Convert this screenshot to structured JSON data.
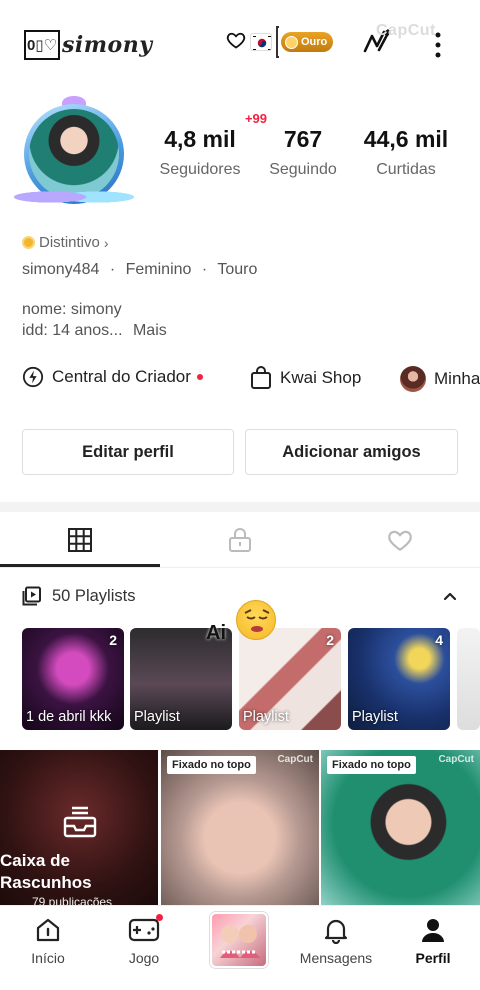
{
  "header": {
    "brand_box": "0▯♡",
    "brand_text": "simony",
    "level_badge": "Ouro",
    "watermark": "CapCut"
  },
  "profile": {
    "notification_badge": "+99",
    "stats": [
      {
        "value": "4,8 mil",
        "label": "Seguidores"
      },
      {
        "value": "767",
        "label": "Seguindo"
      },
      {
        "value": "44,6 mil",
        "label": "Curtidas"
      }
    ],
    "badge_link": "Distintivo",
    "username": "simony484",
    "gender": "Feminino",
    "sign": "Touro",
    "bio_line1": "nome: simony",
    "bio_line2": "idd: 14 anos...",
    "bio_more": "Mais"
  },
  "shortcuts": [
    {
      "label": "Central do Criador"
    },
    {
      "label": "Kwai Shop"
    },
    {
      "label": "Minha"
    }
  ],
  "actions": {
    "edit_profile": "Editar perfil",
    "add_friends": "Adicionar amigos"
  },
  "playlists": {
    "header": "50 Playlists",
    "sticker_text": "Ai",
    "items": [
      {
        "count": "2",
        "label": "1 de abril kkk"
      },
      {
        "count": "",
        "label": "Playlist"
      },
      {
        "count": "2",
        "label": "Playlist"
      },
      {
        "count": "4",
        "label": "Playlist"
      }
    ]
  },
  "posts": {
    "drafts_label": "Caixa de Rascunhos",
    "drafts_count": "79 publicações",
    "pinned_label": "Fixado no topo",
    "post_watermark": "CapCut"
  },
  "bottom_nav": [
    {
      "label": "Início"
    },
    {
      "label": "Jogo"
    },
    {
      "label": "Mensagens"
    },
    {
      "label": "Perfil"
    }
  ],
  "colors": {
    "accent_red": "#f0223f",
    "gold": "#e0a024"
  }
}
